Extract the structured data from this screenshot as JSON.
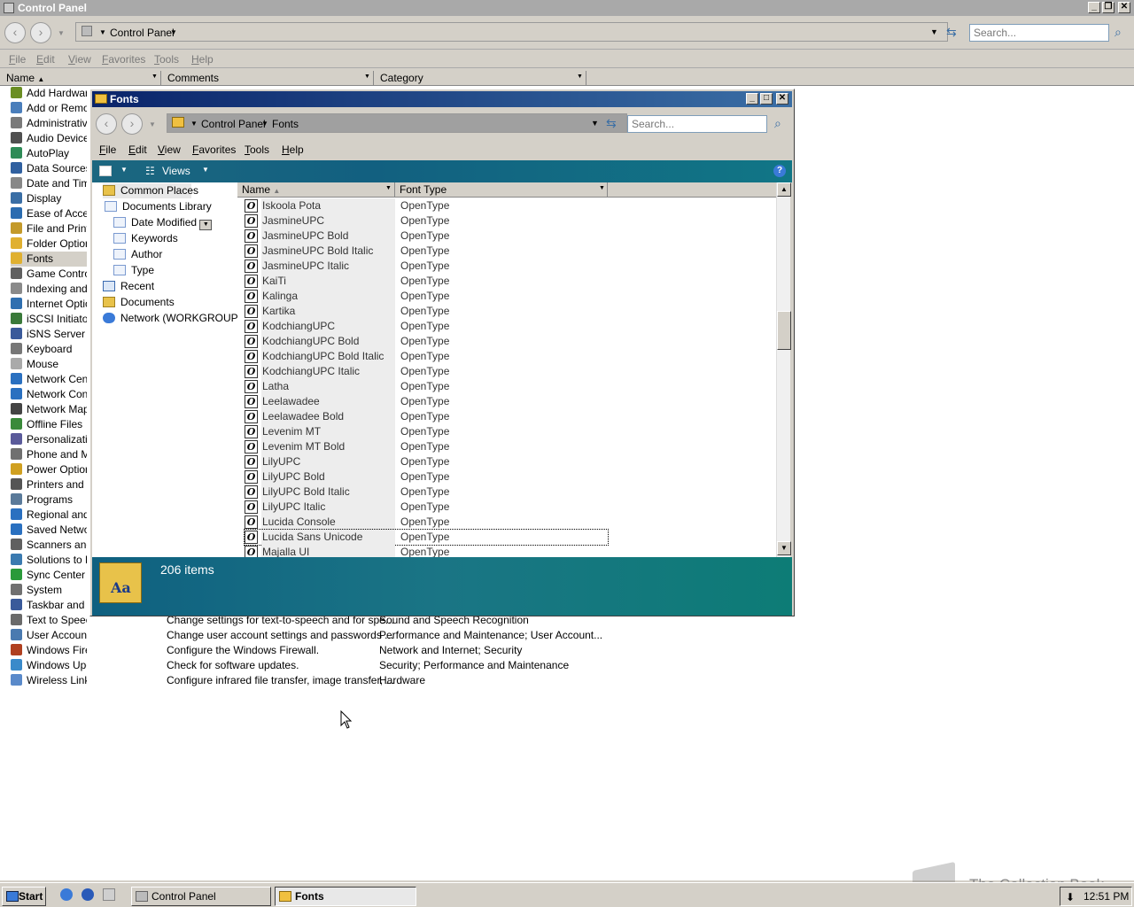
{
  "main_window": {
    "title": "Control Panel",
    "address": "Control Panel",
    "search_placeholder": "Search...",
    "menu": [
      "File",
      "Edit",
      "View",
      "Favorites",
      "Tools",
      "Help"
    ],
    "columns": [
      "Name",
      "Comments",
      "Category"
    ],
    "items": [
      {
        "name": "Add Hardware",
        "color": "#6b8e23"
      },
      {
        "name": "Add or Remove Programs",
        "color": "#4a7ebb"
      },
      {
        "name": "Administrative Tools",
        "color": "#7a7a7a"
      },
      {
        "name": "Audio Devices",
        "color": "#505050"
      },
      {
        "name": "AutoPlay",
        "color": "#2e8b57"
      },
      {
        "name": "Data Sources",
        "color": "#3060a0"
      },
      {
        "name": "Date and Time",
        "color": "#888888"
      },
      {
        "name": "Display",
        "color": "#3a6ea5"
      },
      {
        "name": "Ease of Access",
        "color": "#2b6cb0"
      },
      {
        "name": "File and Printer",
        "color": "#c49a2a"
      },
      {
        "name": "Folder Options",
        "color": "#e0b030"
      },
      {
        "name": "Fonts",
        "color": "#e0b030"
      },
      {
        "name": "Game Controllers",
        "color": "#606060"
      },
      {
        "name": "Indexing and Search",
        "color": "#8a8a8a"
      },
      {
        "name": "Internet Options",
        "color": "#2f6fb0"
      },
      {
        "name": "iSCSI Initiator",
        "color": "#3a7a3a"
      },
      {
        "name": "iSNS Server",
        "color": "#3a5a9a"
      },
      {
        "name": "Keyboard",
        "color": "#777777"
      },
      {
        "name": "Mouse",
        "color": "#aaaaaa"
      },
      {
        "name": "Network Center",
        "color": "#2a70c0"
      },
      {
        "name": "Network Connections",
        "color": "#2a70c0"
      },
      {
        "name": "Network Map",
        "color": "#444444"
      },
      {
        "name": "Offline Files",
        "color": "#3a8a3a"
      },
      {
        "name": "Personalization",
        "color": "#5a5a9a"
      },
      {
        "name": "Phone and Modem",
        "color": "#707070"
      },
      {
        "name": "Power Options",
        "color": "#d0a020"
      },
      {
        "name": "Printers and Faxes",
        "color": "#555555"
      },
      {
        "name": "Programs",
        "color": "#5a7a9a"
      },
      {
        "name": "Regional and Language",
        "color": "#2a70c0"
      },
      {
        "name": "Saved Networks",
        "color": "#2a70c0"
      },
      {
        "name": "Scanners and Cameras",
        "color": "#606060"
      },
      {
        "name": "Solutions to Problems",
        "color": "#3a7ab0"
      },
      {
        "name": "Sync Center",
        "color": "#2a9a3a"
      },
      {
        "name": "System",
        "color": "#707070"
      },
      {
        "name": "Taskbar and Start Menu",
        "color": "#3a5a9a"
      },
      {
        "name": "Text to Speech",
        "color": "#6a6a6a"
      },
      {
        "name": "User Accounts",
        "color": "#4a7ab0"
      },
      {
        "name": "Windows Firewall",
        "color": "#b04020"
      },
      {
        "name": "Windows Update",
        "color": "#3a8aca"
      },
      {
        "name": "Wireless Link",
        "color": "#5a8aca"
      }
    ],
    "right_rows": [
      {
        "comment": "Change settings for text-to-speech and for spe...",
        "category": "Sound and Speech Recognition"
      },
      {
        "comment": "Change user account settings and passwords ...",
        "category": "Performance and Maintenance; User Account..."
      },
      {
        "comment": "Configure the Windows Firewall.",
        "category": "Network and Internet; Security"
      },
      {
        "comment": "Check for software updates.",
        "category": "Security; Performance and Maintenance"
      },
      {
        "comment": "Configure infrared file transfer, image transfer, ...",
        "category": "Hardware"
      }
    ]
  },
  "fonts_window": {
    "title": "Fonts",
    "breadcrumb": [
      "Control Panel",
      "Fonts"
    ],
    "search_placeholder": "Search...",
    "menu": [
      "File",
      "Edit",
      "View",
      "Favorites",
      "Tools",
      "Help"
    ],
    "views_label": "Views",
    "help_glyph": "?",
    "tree": {
      "common_places": "Common Places",
      "documents_library": "Documents Library",
      "date_modified": "Date Modified",
      "keywords": "Keywords",
      "author": "Author",
      "type": "Type",
      "recent": "Recent",
      "documents": "Documents",
      "network": "Network (WORKGROUP)"
    },
    "columns": [
      "Name",
      "Font Type"
    ],
    "fonts": [
      {
        "name": "Iskoola Pota",
        "type": "OpenType"
      },
      {
        "name": "JasmineUPC",
        "type": "OpenType"
      },
      {
        "name": "JasmineUPC Bold",
        "type": "OpenType"
      },
      {
        "name": "JasmineUPC Bold Italic",
        "type": "OpenType"
      },
      {
        "name": "JasmineUPC Italic",
        "type": "OpenType"
      },
      {
        "name": "KaiTi",
        "type": "OpenType"
      },
      {
        "name": "Kalinga",
        "type": "OpenType"
      },
      {
        "name": "Kartika",
        "type": "OpenType"
      },
      {
        "name": "KodchiangUPC",
        "type": "OpenType"
      },
      {
        "name": "KodchiangUPC Bold",
        "type": "OpenType"
      },
      {
        "name": "KodchiangUPC Bold Italic",
        "type": "OpenType"
      },
      {
        "name": "KodchiangUPC Italic",
        "type": "OpenType"
      },
      {
        "name": "Latha",
        "type": "OpenType"
      },
      {
        "name": "Leelawadee",
        "type": "OpenType"
      },
      {
        "name": "Leelawadee Bold",
        "type": "OpenType"
      },
      {
        "name": "Levenim MT",
        "type": "OpenType"
      },
      {
        "name": "Levenim MT Bold",
        "type": "OpenType"
      },
      {
        "name": "LilyUPC",
        "type": "OpenType"
      },
      {
        "name": "LilyUPC Bold",
        "type": "OpenType"
      },
      {
        "name": "LilyUPC Bold Italic",
        "type": "OpenType"
      },
      {
        "name": "LilyUPC Italic",
        "type": "OpenType"
      },
      {
        "name": "Lucida Console",
        "type": "OpenType"
      },
      {
        "name": "Lucida Sans Unicode",
        "type": "OpenType"
      },
      {
        "name": "Majalla UI",
        "type": "OpenType"
      }
    ],
    "selected_font": "Lucida Sans Unicode",
    "status": "206 items"
  },
  "taskbar": {
    "start": "Start",
    "buttons": [
      "Control Panel",
      "Fonts"
    ],
    "clock": "12:51 PM"
  },
  "watermark": "The Collection Book"
}
